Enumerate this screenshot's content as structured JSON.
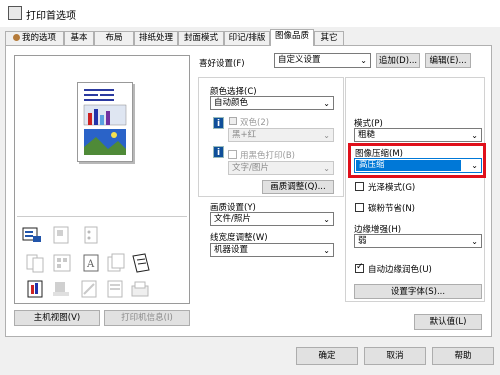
{
  "window": {
    "title": "打印首选项"
  },
  "tabs": [
    {
      "label": "我的选项"
    },
    {
      "label": "基本"
    },
    {
      "label": "布局"
    },
    {
      "label": "排纸处理"
    },
    {
      "label": "封面模式"
    },
    {
      "label": "印记/排版"
    },
    {
      "label": "图像品质"
    },
    {
      "label": "其它"
    }
  ],
  "active_tab": "图像品质",
  "favorites": {
    "label": "喜好设置(F)",
    "value": "自定义设置",
    "add_button": "追加(D)...",
    "edit_button": "编辑(E)..."
  },
  "color_group": {
    "label": "颜色选择(C)",
    "value": "自动颜色",
    "dual_color_label": "双色(2)",
    "dual_color_value": "黑+红",
    "bw_print_label": "用黑色打印(B)",
    "bw_print_value": "文字/图片",
    "adjust_button": "画质调整(Q)..."
  },
  "quality": {
    "label": "画质设置(Y)",
    "value": "文件/照片"
  },
  "line_width": {
    "label": "线宽度调整(W)",
    "value": "机器设置"
  },
  "right_group": {
    "mode_label": "模式(P)",
    "mode_value": "粗糙",
    "compression_label": "图像压缩(M)",
    "compression_value": "高压缩",
    "gloss_label": "光泽模式(G)",
    "toner_label": "碳粉节省(N)",
    "edge_label": "边缘增强(H)",
    "edge_value": "弱",
    "auto_trap_label": "自动边缘润色(U)",
    "font_button": "设置字体(S)..."
  },
  "view_buttons": {
    "main_view": "主机视图(V)",
    "printer_info": "打印机信息(I)"
  },
  "default_button": "默认值(L)",
  "footer": {
    "ok": "确定",
    "cancel": "取消",
    "help": "帮助"
  },
  "highlight_color": "#e0101b",
  "selection_color": "#0078d7"
}
